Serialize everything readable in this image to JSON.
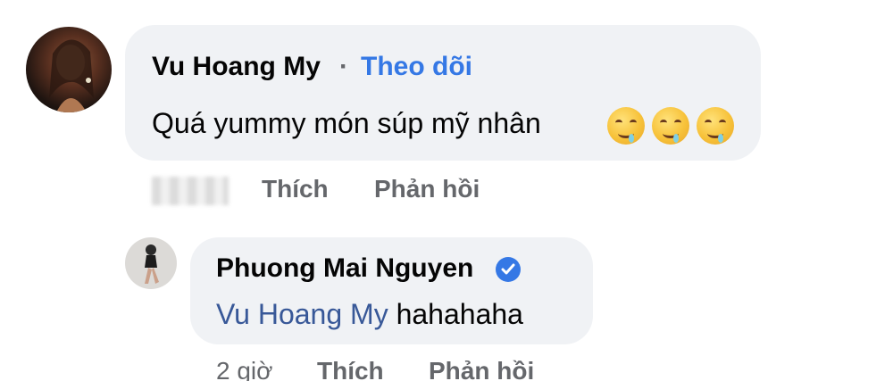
{
  "comments": [
    {
      "author": "Vu Hoang My",
      "separator": "·",
      "follow_label": "Theo dõi",
      "text": "Quá yummy món súp mỹ nhân",
      "emojis": [
        "drooling-face-icon",
        "drooling-face-icon",
        "drooling-face-icon"
      ],
      "actions": {
        "like": "Thích",
        "reply": "Phản hồi"
      }
    },
    {
      "author": "Phuong Mai Nguyen",
      "verified": true,
      "mention": "Vu Hoang My",
      "text": "hahahaha",
      "time": "2 giờ",
      "actions": {
        "like": "Thích",
        "reply": "Phản hồi"
      }
    }
  ],
  "colors": {
    "bubble_bg": "#f0f2f5",
    "link_blue": "#3578e5",
    "mention_blue": "#385898",
    "meta_gray": "#65676b"
  }
}
